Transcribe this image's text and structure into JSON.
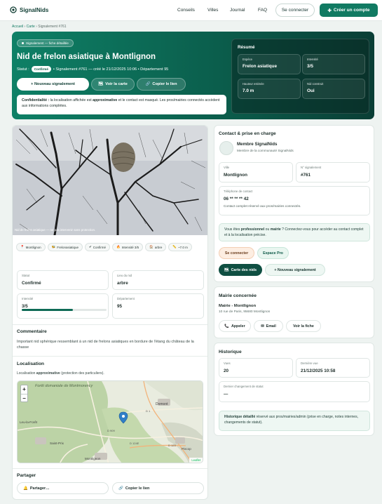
{
  "header": {
    "brand": "SignalNids",
    "nav": [
      "Conseils",
      "Villes",
      "Journal",
      "FAQ"
    ],
    "login": "Se connecter",
    "create_account": "Créer un compte"
  },
  "breadcrumb": {
    "home": "Accueil",
    "map": "Carte",
    "current": "Signalement #761"
  },
  "hero": {
    "badge": "Signalement — fiche détaillée",
    "title": "Nid de frelon asiatique à Montlignon",
    "status_label": "Statut :",
    "status_value": "Confirmé",
    "meta": "• Signalement #761 — créé le 21/12/2025 10:06 • Département 95",
    "btn_new": "+ Nouveau signalement",
    "btn_map": "Voir la carte",
    "btn_copy": "Copier le lien",
    "privacy_bold": "Confidentialité :",
    "privacy_text1": " la localisation affichée est ",
    "privacy_bold2": "approximative",
    "privacy_text2": " et le contact est masqué. Les pros/mairies connectés accèdent aux informations complètes."
  },
  "resume": {
    "title": "Résumé",
    "cards": [
      {
        "label": "Espèce",
        "value": "Frelon asiatique"
      },
      {
        "label": "Intensité",
        "value": "3/5"
      },
      {
        "label": "Hauteur estimée",
        "value": "7.0 m"
      },
      {
        "label": "Nid construit",
        "value": "Oui"
      }
    ]
  },
  "photo": {
    "caption": "Nid de frelon asiatique — ne pas intervenir sans protection."
  },
  "tags": [
    {
      "icon": "pin-icon",
      "glyph": "📍",
      "label": "Montlignon"
    },
    {
      "icon": "bug-icon",
      "glyph": "🐝",
      "label": "Frelonasiatique"
    },
    {
      "icon": "check-icon",
      "glyph": "✔",
      "label": "Confirmé"
    },
    {
      "icon": "fire-icon",
      "glyph": "🔥",
      "label": "Intensité 3/5"
    },
    {
      "icon": "home-icon",
      "glyph": "🏠",
      "label": "arbre"
    },
    {
      "icon": "ruler-icon",
      "glyph": "📏",
      "label": "~7.0 m"
    }
  ],
  "details": {
    "status_label": "Statut",
    "status_value": "Confirmé",
    "place_label": "Lieu du nid",
    "place_value": "arbre",
    "intensity_label": "Intensité",
    "intensity_value": "3/5",
    "intensity_fraction": 0.6,
    "dept_label": "Département",
    "dept_value": "95"
  },
  "comment": {
    "title": "Commentaire",
    "text": "Important nid sphérique ressemblant à un nid de frelons asiatiques en bordure de l'étang du château de la chasse"
  },
  "location": {
    "title": "Localisation",
    "text_pre": "Localisation ",
    "text_bold": "approximative",
    "text_post": " (protection des particuliers).",
    "map_labels": [
      "Forêt domaniale de Montmorency",
      "Domont",
      "Saint-Prix",
      "Montlignon",
      "Leu-la-Forêt",
      "Piscop",
      "D 909",
      "D 124E",
      "D 123",
      "D 1"
    ],
    "zoom_in": "+",
    "zoom_out": "−",
    "attribution": "Leaflet"
  },
  "share": {
    "title": "Partager",
    "btn_share": "Partager…",
    "btn_copy": "Copier le lien"
  },
  "contact": {
    "title": "Contact & prise en charge",
    "member_name": "Membre SignalNids",
    "member_sub": "Membre de la communauté SignalNids",
    "city_label": "Ville",
    "city_value": "Montlignon",
    "num_label": "N° signalement",
    "num_value": "#761",
    "phone_label": "Téléphone de contact",
    "phone_value": "06 ** ** ** 42",
    "phone_note": "Contact complet réservé aux pros/mairies connectés.",
    "notice_pre": "Vous êtes ",
    "notice_b1": "professionnel",
    "notice_mid": " ou ",
    "notice_b2": "mairie",
    "notice_post": " ? Connectez-vous pour accéder au contact complet et à la localisation précise.",
    "btn_login": "Se connecter",
    "btn_pro": "Espace Pro",
    "btn_map": "Carte des nids",
    "btn_new": "+ Nouveau signalement"
  },
  "mairie": {
    "title": "Mairie concernée",
    "name": "Mairie - Montlignon",
    "address": "10 rue de Paris, 95680 Montlignon",
    "btn_call": "Appeler",
    "btn_email": "Email",
    "btn_view": "Voir la fiche"
  },
  "history": {
    "title": "Historique",
    "views_label": "Vues",
    "views_value": "20",
    "last_view_label": "Dernière vue",
    "last_view_value": "21/12/2025 10:58",
    "status_change_label": "Dernier changement de statut",
    "status_change_value": "—",
    "notice_bold": "Historique détaillé",
    "notice_text": " réservé aux pros/mairies/admin (prise en charge, notes internes, changements de statut)."
  },
  "colors": {
    "accent": "#117a62",
    "hero_dark": "#0a3e35",
    "login_button": "#fdeee2"
  }
}
